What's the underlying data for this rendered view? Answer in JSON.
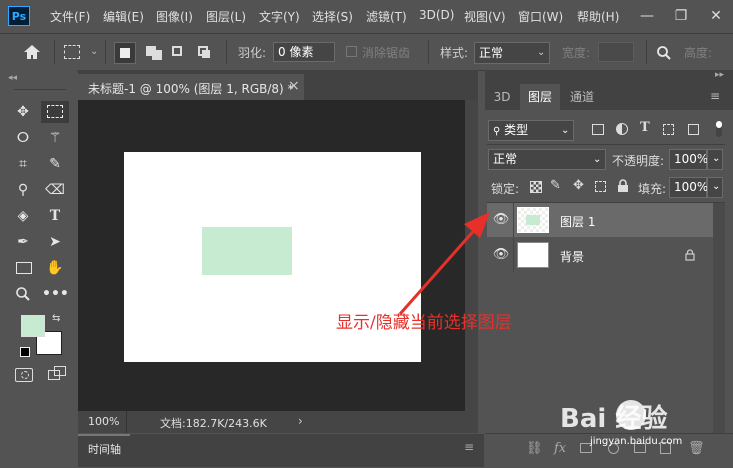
{
  "menubar": {
    "logo": "Ps",
    "items": [
      "文件(F)",
      "编辑(E)",
      "图像(I)",
      "图层(L)",
      "文字(Y)",
      "选择(S)",
      "滤镜(T)",
      "3D(D)",
      "视图(V)",
      "窗口(W)",
      "帮助(H)"
    ],
    "minimize": "—",
    "restore": "❐",
    "close": "✕"
  },
  "optionsbar": {
    "feather_label": "羽化:",
    "feather_value": "0 像素",
    "antialias_label": "消除锯齿",
    "style_label": "样式:",
    "style_value": "正常",
    "width_label": "宽度:",
    "height_label": "高度:"
  },
  "toolbar": {
    "collapse": "◂◂",
    "foreground_color": "#c7ebd1",
    "background_color": "#ffffff"
  },
  "document": {
    "tab_title": "未标题-1 @ 100% (图层 1, RGB/8) *",
    "tab_close": "×",
    "zoom": "100%",
    "doc_info": "文档:182.7K/243.6K",
    "status_arrow": "›",
    "layer_fill_color": "#c7ebd1"
  },
  "timeline": {
    "label": "时间轴"
  },
  "layers_panel": {
    "collapse": "▸▸",
    "tabs": [
      "3D",
      "图层",
      "通道"
    ],
    "active_tab": "图层",
    "filter_kind": "类型",
    "blend_mode": "正常",
    "opacity_label": "不透明度:",
    "opacity_value": "100%",
    "lock_label": "锁定:",
    "fill_label": "填充:",
    "fill_value": "100%",
    "layers": [
      {
        "name": "图层 1",
        "selected": true
      },
      {
        "name": "背景",
        "selected": false
      }
    ]
  },
  "annotation": {
    "text": "显示/隐藏当前选择图层",
    "color": "#e8302a"
  },
  "watermark": {
    "brand": "Bai  经验",
    "url": "jingyan.baidu.com"
  }
}
